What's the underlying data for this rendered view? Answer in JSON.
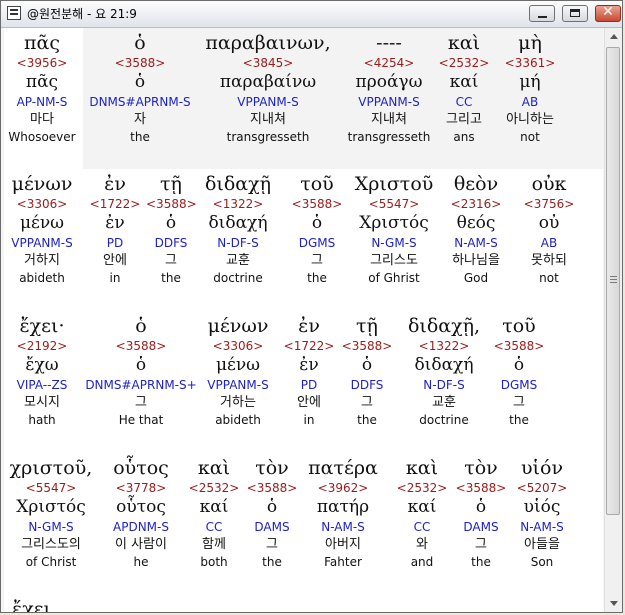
{
  "window": {
    "title": "@원전분해 - 요 21:9",
    "min_label": "–",
    "max_label": "□",
    "close_label": "✕"
  },
  "rows": [
    [
      {
        "greek": "πᾶς",
        "strong": "<3956>",
        "lemma": "πᾶς",
        "parse": "AP-NM-S",
        "korean": "마다",
        "english": "Whosoever"
      },
      {
        "greek": "ὁ",
        "strong": "<3588>",
        "lemma": "ὁ",
        "parse": "DNMS#APRNM-S",
        "korean": "자",
        "english": "the"
      },
      {
        "greek": "παραβαινων,",
        "strong": "<3845>",
        "lemma": "παραβαίνω",
        "parse": "VPPANM-S",
        "korean": "지내쳐",
        "english": "transgresseth"
      },
      {
        "greek": "----",
        "strong": "<4254>",
        "lemma": "προάγω",
        "parse": "VPPANM-S",
        "korean": "지내쳐",
        "english": "transgresseth"
      },
      {
        "greek": "καὶ",
        "strong": "<2532>",
        "lemma": "καί",
        "parse": "CC",
        "korean": "그리고",
        "english": "ans"
      },
      {
        "greek": "μὴ",
        "strong": "<3361>",
        "lemma": "μή",
        "parse": "AB",
        "korean": "아니하는",
        "english": "not"
      }
    ],
    [
      {
        "greek": "μένων",
        "strong": "<3306>",
        "lemma": "μένω",
        "parse": "VPPANM-S",
        "korean": "거하지",
        "english": "abideth"
      },
      {
        "greek": "ἐν",
        "strong": "<1722>",
        "lemma": "ἐν",
        "parse": "PD",
        "korean": "안에",
        "english": "in"
      },
      {
        "greek": "τῇ",
        "strong": "<3588>",
        "lemma": "ὁ",
        "parse": "DDFS",
        "korean": "그",
        "english": "the"
      },
      {
        "greek": "διδαχῇ",
        "strong": "<1322>",
        "lemma": "διδαχή",
        "parse": "N-DF-S",
        "korean": "교훈",
        "english": "doctrine"
      },
      {
        "greek": "τοῦ",
        "strong": "<3588>",
        "lemma": "ὁ",
        "parse": "DGMS",
        "korean": "그",
        "english": "the"
      },
      {
        "greek": "Χριστοῦ",
        "strong": "<5547>",
        "lemma": "Χριστός",
        "parse": "N-GM-S",
        "korean": "그리스도",
        "english": "of Ghrist"
      },
      {
        "greek": "θεὸν",
        "strong": "<2316>",
        "lemma": "θεός",
        "parse": "N-AM-S",
        "korean": "하나님을",
        "english": "God"
      },
      {
        "greek": "οὐκ",
        "strong": "<3756>",
        "lemma": "οὐ",
        "parse": "AB",
        "korean": "못하되",
        "english": "not"
      }
    ],
    [
      {
        "greek": "ἔχει·",
        "strong": "<2192>",
        "lemma": "ἔχω",
        "parse": "VIPA--ZS",
        "korean": "모시지",
        "english": "hath"
      },
      {
        "greek": "ὁ",
        "strong": "<3588>",
        "lemma": "ὁ",
        "parse": "DNMS#APRNM-S+",
        "korean": "그",
        "english": "He that"
      },
      {
        "greek": "μένων",
        "strong": "<3306>",
        "lemma": "μένω",
        "parse": "VPPANM-S",
        "korean": "거하는",
        "english": "abideth"
      },
      {
        "greek": "ἐν",
        "strong": "<1722>",
        "lemma": "ἐν",
        "parse": "PD",
        "korean": "안에",
        "english": "in"
      },
      {
        "greek": "τῇ",
        "strong": "<3588>",
        "lemma": "ὁ",
        "parse": "DDFS",
        "korean": "그",
        "english": "the"
      },
      {
        "greek": "διδαχῇ,",
        "strong": "<1322>",
        "lemma": "διδαχή",
        "parse": "N-DF-S",
        "korean": "교훈",
        "english": "doctrine"
      },
      {
        "greek": "τοῦ",
        "strong": "<3588>",
        "lemma": "ὁ",
        "parse": "DGMS",
        "korean": "그",
        "english": "the"
      }
    ],
    [
      {
        "greek": "χριστοῦ,",
        "strong": "<5547>",
        "lemma": "Χριστός",
        "parse": "N-GM-S",
        "korean": "그리스도의",
        "english": "of Christ"
      },
      {
        "greek": "οὗτος",
        "strong": "<3778>",
        "lemma": "οὗτος",
        "parse": "APDNM-S",
        "korean": "이 사람이",
        "english": "he"
      },
      {
        "greek": "καὶ",
        "strong": "<2532>",
        "lemma": "καί",
        "parse": "CC",
        "korean": "함께",
        "english": "both"
      },
      {
        "greek": "τὸν",
        "strong": "<3588>",
        "lemma": "ὁ",
        "parse": "DAMS",
        "korean": "그",
        "english": "the"
      },
      {
        "greek": "πατέρα",
        "strong": "<3962>",
        "lemma": "πατήρ",
        "parse": "N-AM-S",
        "korean": "아버지",
        "english": "Fahter"
      },
      {
        "greek": "καὶ",
        "strong": "<2532>",
        "lemma": "καί",
        "parse": "CC",
        "korean": "와",
        "english": "and"
      },
      {
        "greek": "τὸν",
        "strong": "<3588>",
        "lemma": "ὁ",
        "parse": "DAMS",
        "korean": "그",
        "english": "the"
      },
      {
        "greek": "υἱόν",
        "strong": "<5207>",
        "lemma": "υἱός",
        "parse": "N-AM-S",
        "korean": "아들을",
        "english": "Son"
      }
    ]
  ],
  "cutoff_word": "ἔχει"
}
